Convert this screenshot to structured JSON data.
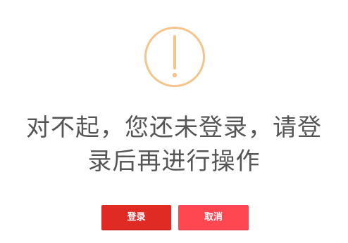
{
  "dialog": {
    "icon": "exclamation-circle-icon",
    "icon_color": "#f5c48c",
    "message_lines": [
      "对不起，您还未登录，请登",
      "录后再进行操作"
    ],
    "buttons": {
      "login_label": "登录",
      "login_color": "#e02b24",
      "cancel_label": "取消",
      "cancel_color": "#ff4752"
    }
  }
}
